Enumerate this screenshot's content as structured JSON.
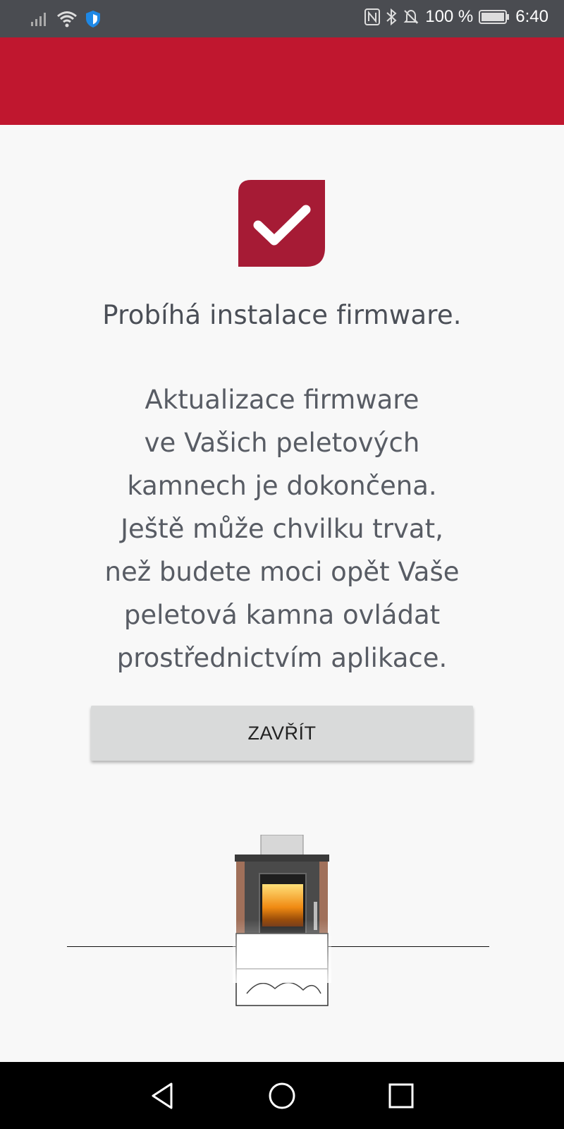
{
  "status_bar": {
    "left_icons": [
      "signal-icon",
      "wifi-icon",
      "shield-icon"
    ],
    "right_icons": [
      "nfc-icon",
      "bluetooth-icon",
      "bell-off-icon",
      "battery-icon"
    ],
    "battery": "100 %",
    "time": "6:40"
  },
  "colors": {
    "brand_red": "#c0172f",
    "status_bar": "#4a4c51",
    "button": "#d9dada",
    "background": "#f8f8f8"
  },
  "dialog": {
    "icon": "checkmark-icon",
    "title": "Probíhá instalace firmware.",
    "message": "Aktualizace firmware\nve Vašich peletových\nkamnech je dokončena.\nJeště může chvilku trvat,\nnež budete moci opět Vaše\npeletová kamna ovládat\nprostřednictvím aplikace.",
    "close_label": "ZAVŘÍT"
  },
  "illustration": "pellet-stove-icon",
  "nav_bar": [
    "back-icon",
    "home-icon",
    "recents-icon"
  ]
}
